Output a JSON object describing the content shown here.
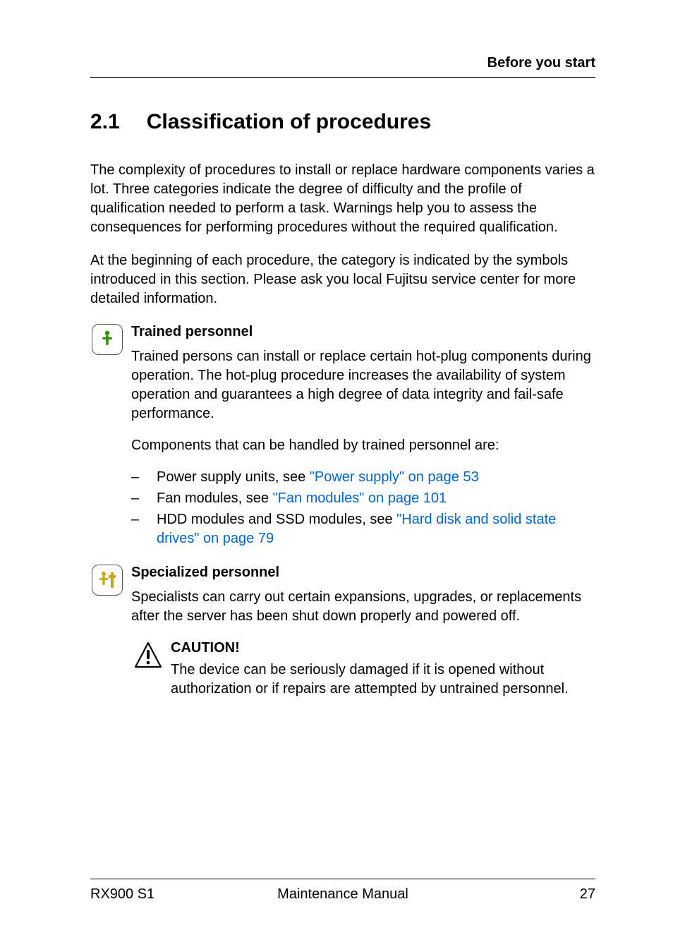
{
  "header": {
    "running_title": "Before you start"
  },
  "section": {
    "number": "2.1",
    "title": "Classification of procedures"
  },
  "paragraphs": {
    "intro1": "The complexity of procedures to install or replace hardware components varies a lot. Three categories indicate the degree of difficulty and the profile of qualification needed to perform a task. Warnings help you to assess the consequences for performing procedures without the required qualification.",
    "intro2": "At the beginning of each procedure, the category is indicated by the symbols introduced in this section. Please ask you local Fujitsu service center for more detailed information."
  },
  "trained": {
    "title": "Trained personnel",
    "para1": "Trained persons can install or replace certain hot-plug components during operation. The hot-plug procedure increases the availability of system operation and guarantees a high degree of data integrity and fail-safe performance.",
    "para2": "Components that can be handled by trained personnel are:",
    "items": [
      {
        "prefix": "Power supply units, see ",
        "link": "\"Power supply\" on page 53"
      },
      {
        "prefix": "Fan modules, see ",
        "link": "\"Fan modules\" on page 101"
      },
      {
        "prefix": "HDD modules and SSD modules, see ",
        "link": "\"Hard disk and solid state drives\" on page 79"
      }
    ]
  },
  "specialized": {
    "title": "Specialized personnel",
    "para1": "Specialists can carry out certain expansions, upgrades, or replacements after the server has been shut down properly and powered off.",
    "caution_label": "CAUTION!",
    "caution_text": "The device can be seriously damaged if it is opened without authorization or if repairs are attempted by untrained personnel."
  },
  "footer": {
    "left": "RX900 S1",
    "center": "Maintenance Manual",
    "right": "27"
  }
}
